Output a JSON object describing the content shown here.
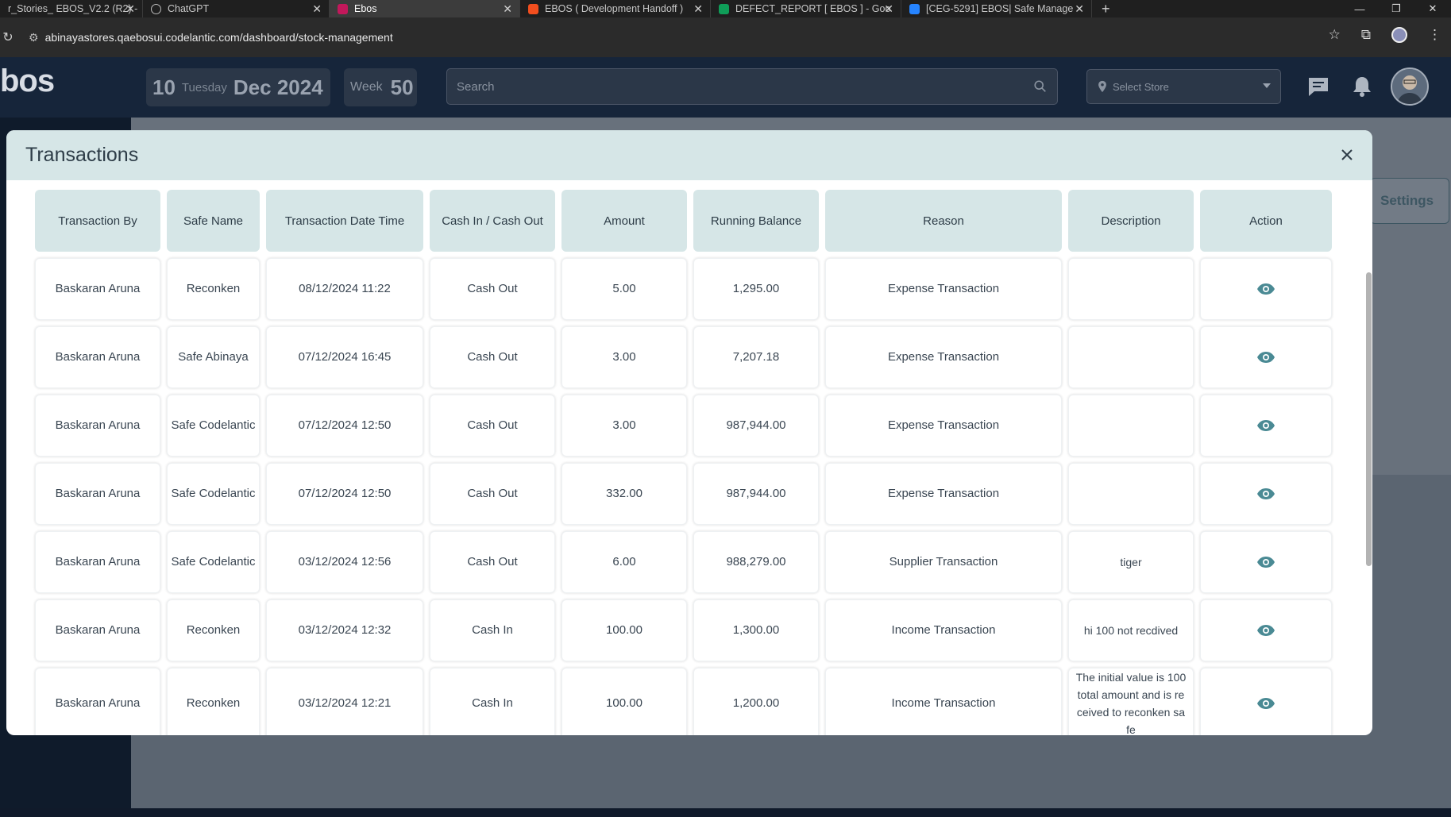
{
  "browser": {
    "tabs": [
      {
        "title": "r_Stories_ EBOS_V2.2 (R2) -",
        "color": "#2b2b2b"
      },
      {
        "title": "ChatGPT",
        "color": "#9a9a9a"
      },
      {
        "title": "Ebos",
        "color": "#c2185b"
      },
      {
        "title": "EBOS ( Development Handoff )",
        "color": "#f24e1e"
      },
      {
        "title": "DEFECT_REPORT [ EBOS ] - Goo",
        "color": "#0f9d58"
      },
      {
        "title": "[CEG-5291] EBOS| Safe Manage",
        "color": "#2684ff"
      }
    ],
    "new_tab": "+",
    "url": "abinayastores.qaebosui.codelantic.com/dashboard/stock-management"
  },
  "header": {
    "logo": "bos",
    "date_day": "10",
    "date_weekday": "Tuesday",
    "date_month_year": "Dec 2024",
    "week_label": "Week",
    "week_number": "50",
    "search_placeholder": "Search",
    "store_placeholder": "Select Store"
  },
  "background": {
    "settings_label": "Settings"
  },
  "modal": {
    "title": "Transactions",
    "columns": [
      "Transaction By",
      "Safe Name",
      "Transaction Date Time",
      "Cash In / Cash Out",
      "Amount",
      "Running Balance",
      "Reason",
      "Description",
      "Action"
    ],
    "rows": [
      {
        "by": "Baskaran Aruna",
        "safe": "Reconken",
        "datetime": "08/12/2024 11:22",
        "type": "Cash Out",
        "amount": "5.00",
        "balance": "1,295.00",
        "reason": "Expense Transaction",
        "description": ""
      },
      {
        "by": "Baskaran Aruna",
        "safe": "Safe Abinaya",
        "datetime": "07/12/2024 16:45",
        "type": "Cash Out",
        "amount": "3.00",
        "balance": "7,207.18",
        "reason": "Expense Transaction",
        "description": ""
      },
      {
        "by": "Baskaran Aruna",
        "safe": "Safe Codelantic",
        "datetime": "07/12/2024 12:50",
        "type": "Cash Out",
        "amount": "3.00",
        "balance": "987,944.00",
        "reason": "Expense Transaction",
        "description": ""
      },
      {
        "by": "Baskaran Aruna",
        "safe": "Safe Codelantic",
        "datetime": "07/12/2024 12:50",
        "type": "Cash Out",
        "amount": "332.00",
        "balance": "987,944.00",
        "reason": "Expense Transaction",
        "description": ""
      },
      {
        "by": "Baskaran Aruna",
        "safe": "Safe Codelantic",
        "datetime": "03/12/2024 12:56",
        "type": "Cash Out",
        "amount": "6.00",
        "balance": "988,279.00",
        "reason": "Supplier Transaction",
        "description": "tiger"
      },
      {
        "by": "Baskaran Aruna",
        "safe": "Reconken",
        "datetime": "03/12/2024 12:32",
        "type": "Cash In",
        "amount": "100.00",
        "balance": "1,300.00",
        "reason": "Income Transaction",
        "description": "hi 100 not recdived"
      },
      {
        "by": "Baskaran Aruna",
        "safe": "Reconken",
        "datetime": "03/12/2024 12:21",
        "type": "Cash In",
        "amount": "100.00",
        "balance": "1,200.00",
        "reason": "Income Transaction",
        "description": "The initial value is 100 total amount and is re ceived to reconken sa fe"
      }
    ],
    "action_icon": "eye-icon"
  },
  "colors": {
    "header_bg": "#d6e6e7",
    "eye_icon": "#4a8a94",
    "app_header": "#16253a"
  }
}
